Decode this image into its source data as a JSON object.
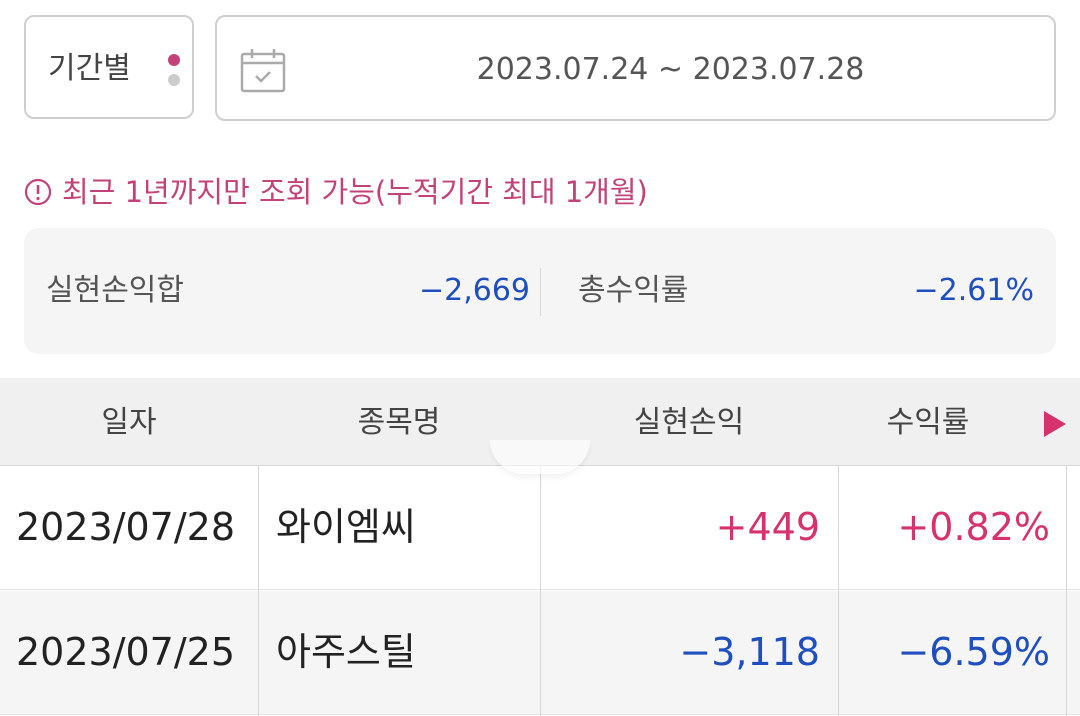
{
  "colors": {
    "accent": "#c2437a",
    "positive": "#d6336c",
    "negative": "#1f4fbf",
    "dot_inactive": "#cccccc"
  },
  "filter": {
    "period_label": "기간별",
    "date_range": "2023.07.24 ~ 2023.07.28",
    "calendar_icon": "calendar-icon"
  },
  "notice": {
    "icon": "alert-circle-icon",
    "text": "최근 1년까지만 조회 가능(누적기간 최대 1개월)"
  },
  "summary": {
    "realized_label": "실현손익합",
    "realized_value": "−2,669",
    "return_label": "총수익률",
    "return_value": "−2.61%"
  },
  "table": {
    "headers": [
      "일자",
      "종목명",
      "실현손익",
      "수익률"
    ],
    "rows": [
      {
        "date": "2023/07/28",
        "name": "와이엠씨",
        "pnl": "+449",
        "rate": "+0.82%"
      },
      {
        "date": "2023/07/25",
        "name": "아주스틸",
        "pnl": "−3,118",
        "rate": "−6.59%"
      }
    ]
  }
}
